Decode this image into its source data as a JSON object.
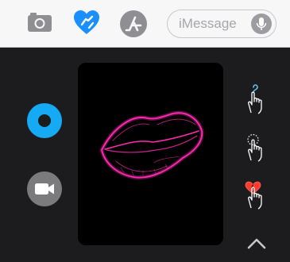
{
  "toolbar": {
    "camera_icon": "camera-icon",
    "digital_touch_icon": "heart-hands-icon",
    "app_store_icon": "app-store-icon",
    "message_placeholder": "iMessage",
    "mic_icon": "microphone-icon"
  },
  "digital_touch": {
    "canvas_effect": "kiss-lips",
    "colors": {
      "sketch_active": "#15aaf3",
      "kiss_pink": "#ff2bb0",
      "gesture_blue": "#5ac8fa",
      "heartbreak_red": "#ff3b30"
    },
    "left_controls": [
      "sketch-color-button",
      "video-camera-button"
    ],
    "gesture_hints": [
      "tap-gesture-icon",
      "touch-hold-gesture-icon",
      "heartbreak-gesture-icon"
    ],
    "collapse_icon": "chevron-up-icon"
  }
}
